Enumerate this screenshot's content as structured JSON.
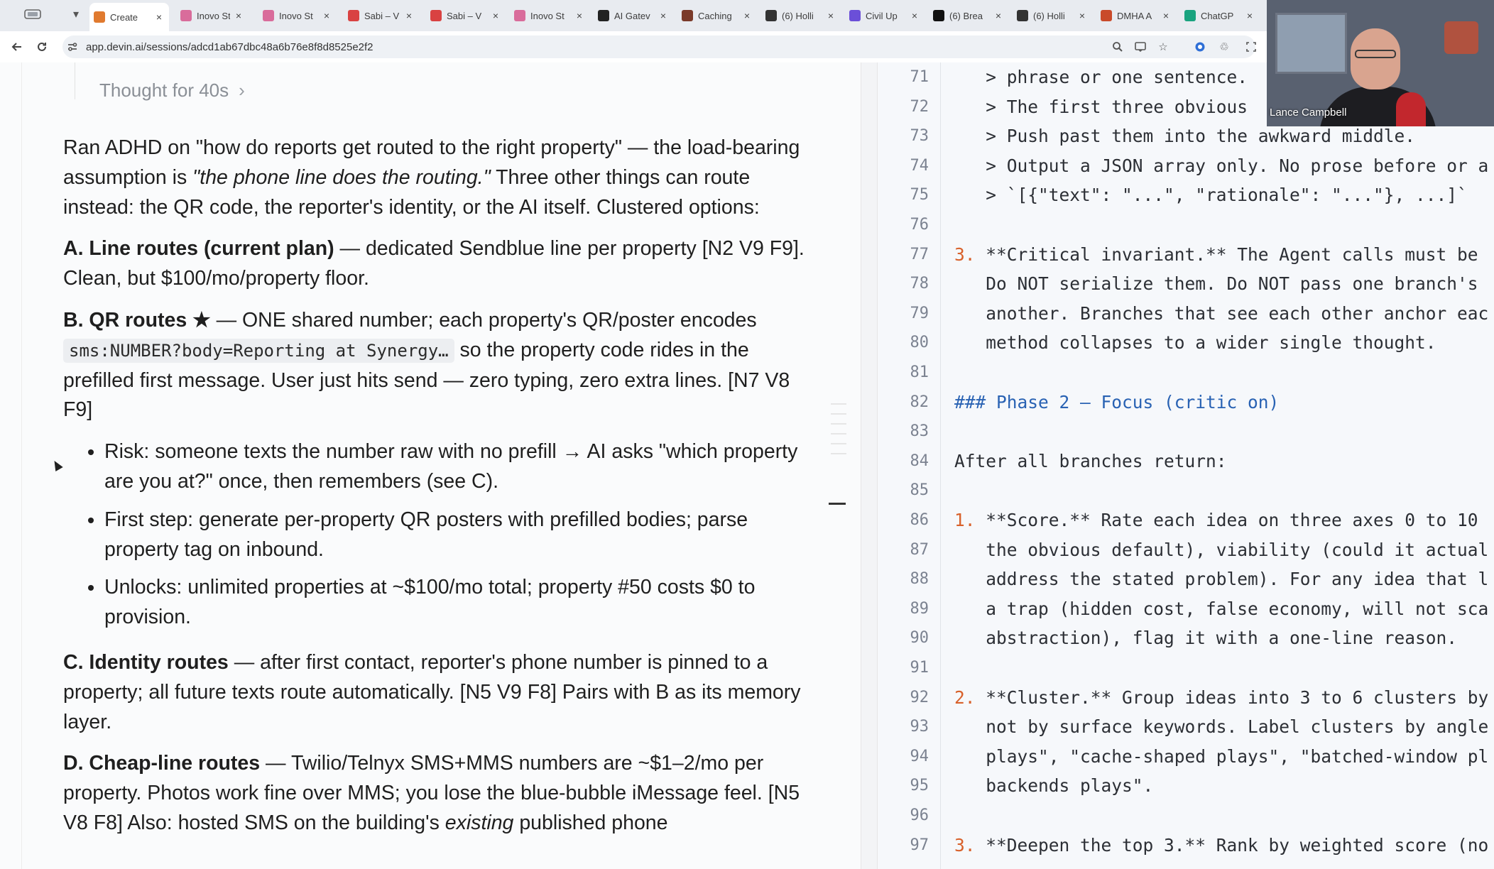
{
  "browser": {
    "tabs": [
      {
        "title": "Create",
        "fav": "#e07a2f",
        "active": true
      },
      {
        "title": "Inovo St",
        "fav": "#d96c9b"
      },
      {
        "title": "Inovo St",
        "fav": "#d96c9b"
      },
      {
        "title": "Sabi – V",
        "fav": "#d94242"
      },
      {
        "title": "Sabi – V",
        "fav": "#d94242"
      },
      {
        "title": "Inovo St",
        "fav": "#d96c9b"
      },
      {
        "title": "AI Gatev",
        "fav": "#222222"
      },
      {
        "title": "Caching",
        "fav": "#7a3a2a"
      },
      {
        "title": "(6) Holli",
        "fav": "#333333"
      },
      {
        "title": "Civil Up",
        "fav": "#6b4fd8"
      },
      {
        "title": "(6) Brea",
        "fav": "#111111"
      },
      {
        "title": "(6) Holli",
        "fav": "#333333"
      },
      {
        "title": "DMHA A",
        "fav": "#c94a2a"
      },
      {
        "title": "ChatGP",
        "fav": "#19a37f"
      }
    ],
    "close_glyph": "×",
    "url": "app.devin.ai/sessions/adcd1ab67dbc48a6b76e8f8d8525e2f2"
  },
  "chat": {
    "thought_label": "Thought for 40s",
    "thought_chevron": "›",
    "intro_prefix": "Ran ADHD on \"how do reports get routed to the right property\" — the load-bearing assumption is ",
    "intro_em": "\"the phone line does the routing.\"",
    "intro_suffix": " Three other things can route instead: the QR code, the reporter's identity, or the AI itself. Clustered options:",
    "option_a_title": "A. Line routes (current plan)",
    "option_a_text": " — dedicated Sendblue line per property [N2 V9 F9]. Clean, but $100/mo/property floor.",
    "option_b_title": "B. QR routes ★",
    "option_b_text": " — ONE shared number; each property's QR/poster encodes ",
    "option_b_code": "sms:NUMBER?body=Reporting at Synergy…",
    "option_b_text2": " so the property code rides in the prefilled first message. User just hits send — zero typing, zero extra lines. [N7 V8 F9]",
    "bullets": [
      "Risk: someone texts the number raw with no prefill → AI asks \"which property are you at?\" once, then remembers (see C).",
      "First step: generate per-property QR posters with prefilled bodies; parse property tag on inbound.",
      "Unlocks: unlimited properties at ~$100/mo total; property #50 costs $0 to provision."
    ],
    "option_c_title": "C. Identity routes",
    "option_c_text": " — after first contact, reporter's phone number is pinned to a property; all future texts route automatically. [N5 V9 F8] Pairs with B as its memory layer.",
    "option_d_title": "D. Cheap-line routes",
    "option_d_text": " — Twilio/Telnyx SMS+MMS numbers are ~$1–2/mo per property. Photos work fine over MMS; you lose the blue-bubble iMessage feel. [N5 V8 F8] Also: hosted SMS on the building's ",
    "option_d_em": "existing",
    "option_d_text2": " published phone"
  },
  "code": {
    "lines": [
      {
        "n": "71",
        "t": "   > phrase or one sentence."
      },
      {
        "n": "72",
        "t": "   > The first three obvious"
      },
      {
        "n": "73",
        "t": "   > Push past them into the awkward middle."
      },
      {
        "n": "74",
        "t": "   > Output a JSON array only. No prose before or a"
      },
      {
        "n": "75",
        "t": "   > `[{\"text\": \"...\", \"rationale\": \"...\"}, ...]`"
      },
      {
        "n": "76",
        "t": ""
      },
      {
        "n": "77",
        "num": "3.",
        "t": " **Critical invariant.** The Agent calls must be"
      },
      {
        "n": "78",
        "t": "   Do NOT serialize them. Do NOT pass one branch's"
      },
      {
        "n": "79",
        "t": "   another. Branches that see each other anchor eac"
      },
      {
        "n": "80",
        "t": "   method collapses to a wider single thought."
      },
      {
        "n": "81",
        "t": ""
      },
      {
        "n": "82",
        "t": "### Phase 2 — Focus (critic on)",
        "heading": true
      },
      {
        "n": "83",
        "t": ""
      },
      {
        "n": "84",
        "t": "After all branches return:"
      },
      {
        "n": "85",
        "t": ""
      },
      {
        "n": "86",
        "num": "1.",
        "t": " **Score.** Rate each idea on three axes 0 to 10"
      },
      {
        "n": "87",
        "t": "   the obvious default), viability (could it actual"
      },
      {
        "n": "88",
        "t": "   address the stated problem). For any idea that l"
      },
      {
        "n": "89",
        "t": "   a trap (hidden cost, false economy, will not sca"
      },
      {
        "n": "90",
        "t": "   abstraction), flag it with a one-line reason."
      },
      {
        "n": "91",
        "t": ""
      },
      {
        "n": "92",
        "num": "2.",
        "t": " **Cluster.** Group ideas into 3 to 6 clusters by"
      },
      {
        "n": "93",
        "t": "   not by surface keywords. Label clusters by angle"
      },
      {
        "n": "94",
        "t": "   plays\", \"cache-shaped plays\", \"batched-window pl"
      },
      {
        "n": "95",
        "t": "   backends plays\"."
      },
      {
        "n": "96",
        "t": ""
      },
      {
        "n": "97",
        "num": "3.",
        "t": " **Deepen the top 3.** Rank by weighted score (no"
      }
    ]
  },
  "webcam": {
    "name": "Lance Campbell"
  }
}
